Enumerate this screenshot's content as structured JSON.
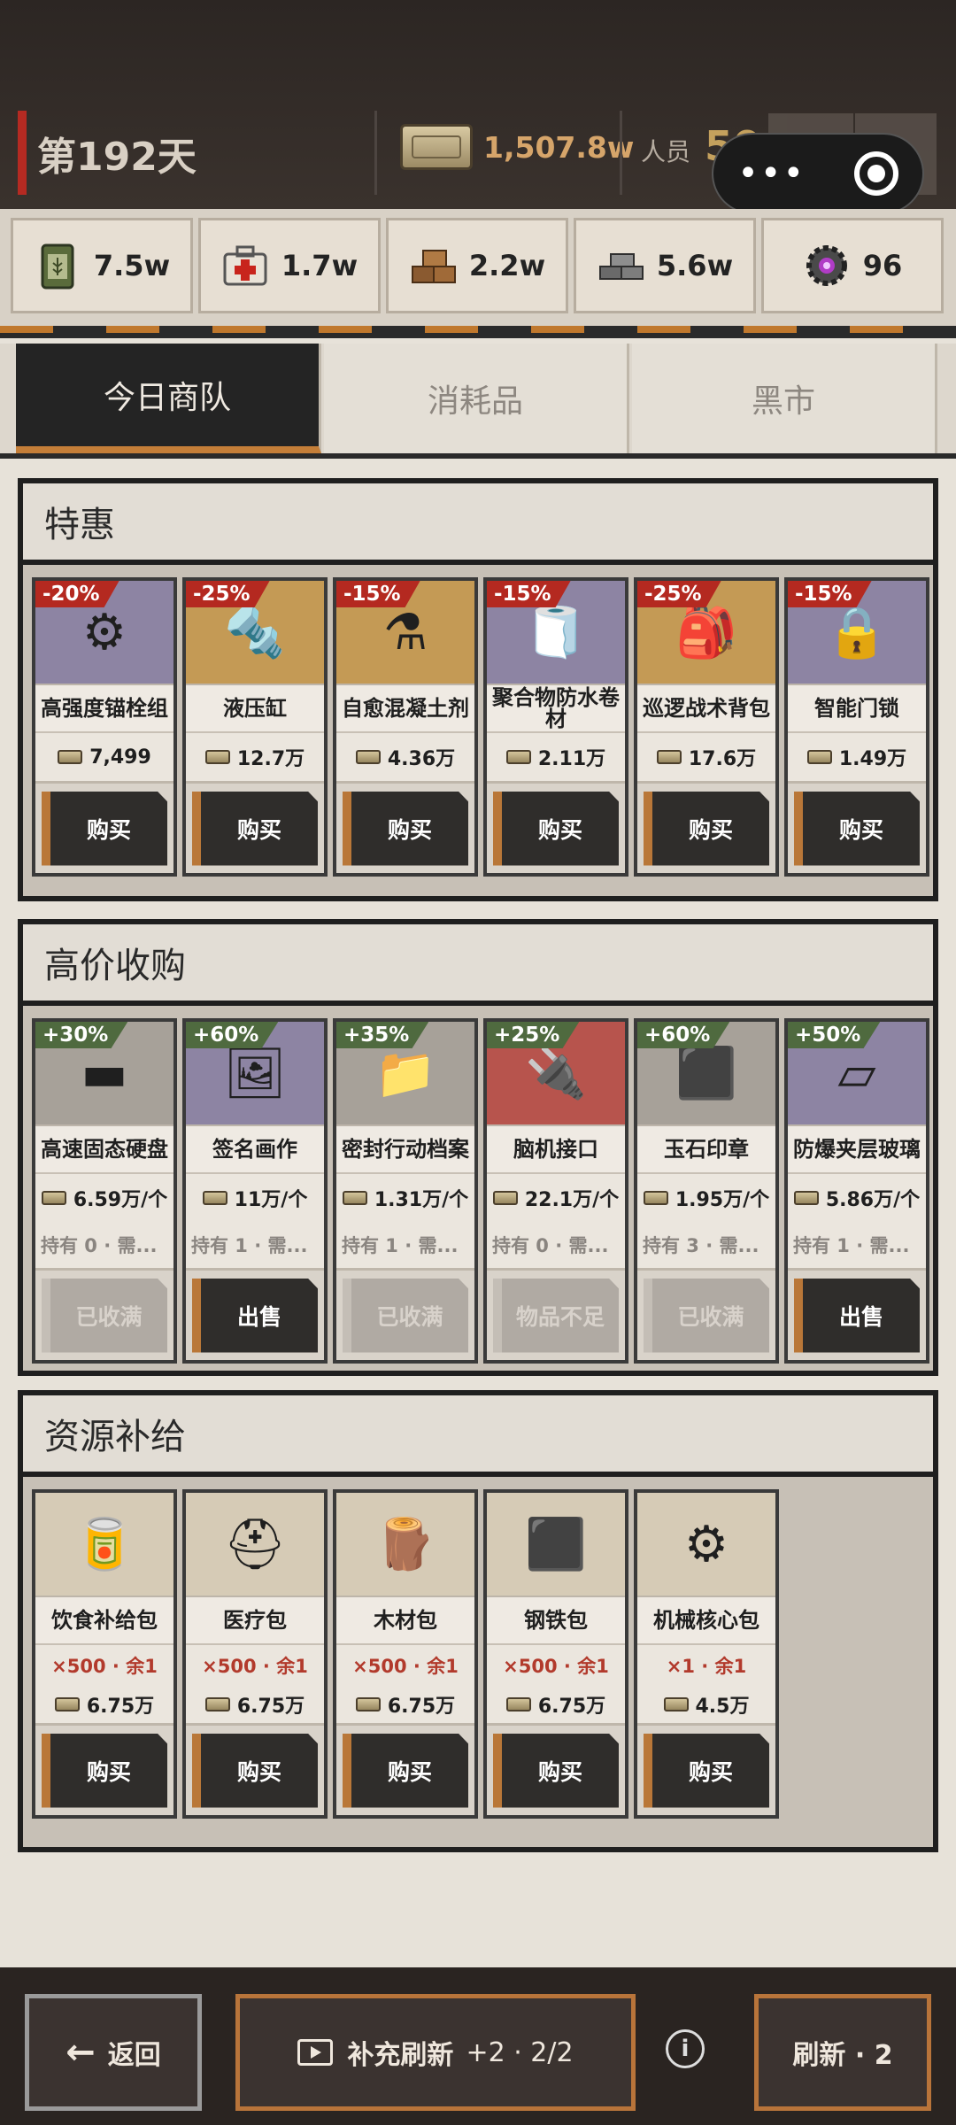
{
  "header": {
    "day": "第192天",
    "money": "1,507.8w",
    "crew_label": "人员",
    "crew_value": "50",
    "mail_icon": "✉",
    "gear_icon": "⚙"
  },
  "resources": [
    {
      "icon": "ration-can-icon",
      "value": "7.5w"
    },
    {
      "icon": "medkit-icon",
      "value": "1.7w"
    },
    {
      "icon": "wood-icon",
      "value": "2.2w"
    },
    {
      "icon": "steel-icon",
      "value": "5.6w"
    },
    {
      "icon": "mech-core-icon",
      "value": "96"
    }
  ],
  "tabs": [
    "今日商队",
    "消耗品",
    "黑市"
  ],
  "specials": {
    "title": "特惠",
    "items": [
      {
        "badge": "-20%",
        "name": "高强度锚栓组",
        "price": "7,499",
        "button": "购买",
        "bg": "#8d84a3",
        "icon": "⚙"
      },
      {
        "badge": "-25%",
        "name": "液压缸",
        "price": "12.7万",
        "button": "购买",
        "bg": "#c49a55",
        "icon": "🔩"
      },
      {
        "badge": "-15%",
        "name": "自愈混凝土剂",
        "price": "4.36万",
        "button": "购买",
        "bg": "#c49a55",
        "icon": "⚗"
      },
      {
        "badge": "-15%",
        "name": "聚合物防水卷材",
        "price": "2.11万",
        "button": "购买",
        "bg": "#8d84a3",
        "icon": "🧻"
      },
      {
        "badge": "-25%",
        "name": "巡逻战术背包",
        "price": "17.6万",
        "button": "购买",
        "bg": "#c49a55",
        "icon": "🎒"
      },
      {
        "badge": "-15%",
        "name": "智能门锁",
        "price": "1.49万",
        "button": "购买",
        "bg": "#8d84a3",
        "icon": "🔒"
      }
    ]
  },
  "buyback": {
    "title": "高价收购",
    "items": [
      {
        "badge": "+30%",
        "name": "高速固态硬盘",
        "price": "6.59万/个",
        "own": "持有 0 · 需...",
        "button": "已收满",
        "enabled": false,
        "bg": "#a7a199",
        "icon": "▬"
      },
      {
        "badge": "+60%",
        "name": "签名画作",
        "price": "11万/个",
        "own": "持有 1 · 需...",
        "button": "出售",
        "enabled": true,
        "bg": "#8d84a3",
        "icon": "🖼"
      },
      {
        "badge": "+35%",
        "name": "密封行动档案",
        "price": "1.31万/个",
        "own": "持有 1 · 需...",
        "button": "已收满",
        "enabled": false,
        "bg": "#a7a199",
        "icon": "📁"
      },
      {
        "badge": "+25%",
        "name": "脑机接口",
        "price": "22.1万/个",
        "own": "持有 0 · 需...",
        "button": "物品不足",
        "enabled": false,
        "bg": "#b7544d",
        "icon": "🔌"
      },
      {
        "badge": "+60%",
        "name": "玉石印章",
        "price": "1.95万/个",
        "own": "持有 3 · 需...",
        "button": "已收满",
        "enabled": false,
        "bg": "#a7a199",
        "icon": "⬛"
      },
      {
        "badge": "+50%",
        "name": "防爆夹层玻璃",
        "price": "5.86万/个",
        "own": "持有 1 · 需...",
        "button": "出售",
        "enabled": true,
        "bg": "#8d84a3",
        "icon": "▱"
      }
    ]
  },
  "supply": {
    "title": "资源补给",
    "items": [
      {
        "name": "饮食补给包",
        "qty": "×500 · 余1",
        "price": "6.75万",
        "button": "购买",
        "icon": "🥫"
      },
      {
        "name": "医疗包",
        "qty": "×500 · 余1",
        "price": "6.75万",
        "button": "购买",
        "icon": "⛑"
      },
      {
        "name": "木材包",
        "qty": "×500 · 余1",
        "price": "6.75万",
        "button": "购买",
        "icon": "🪵"
      },
      {
        "name": "钢铁包",
        "qty": "×500 · 余1",
        "price": "6.75万",
        "button": "购买",
        "icon": "⬛"
      },
      {
        "name": "机械核心包",
        "qty": "×1 · 余1",
        "price": "4.5万",
        "button": "购买",
        "icon": "⚙"
      }
    ]
  },
  "bottom": {
    "back": "返回",
    "back_arrow": "←",
    "refill": "补充刷新",
    "refill_extra": "+2 · 2/2",
    "info": "i",
    "refresh": "刷新 · 2"
  },
  "colors": {
    "accent": "#c47e38",
    "discount": "#b42920",
    "bonus": "#4f6a3f"
  }
}
